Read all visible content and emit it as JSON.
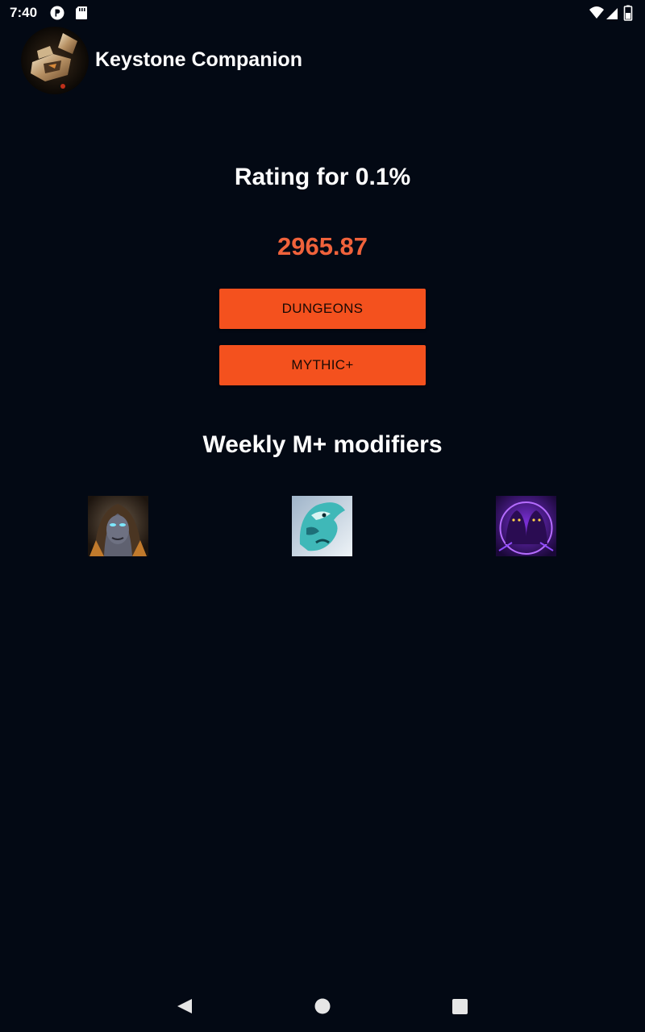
{
  "status_bar": {
    "time": "7:40",
    "left_icons": [
      "notification-p-icon",
      "sd-card-icon"
    ],
    "right_icons": [
      "wifi-icon",
      "cell-signal-icon",
      "battery-icon"
    ]
  },
  "app_bar": {
    "title": "Keystone Companion",
    "logo_icon": "keystone-logo-icon"
  },
  "rating": {
    "heading": "Rating for 0.1%",
    "value": "2965.87",
    "value_color": "#f0623b"
  },
  "buttons": {
    "dungeons_label": "DUNGEONS",
    "mythic_label": "MYTHIC+",
    "color": "#f4511e"
  },
  "modifiers": {
    "heading": "Weekly M+ modifiers",
    "affixes": [
      {
        "icon": "hooded-figure-affix-icon"
      },
      {
        "icon": "spectral-creature-affix-icon"
      },
      {
        "icon": "purple-cultists-affix-icon"
      }
    ]
  },
  "nav_bar": {
    "icons": [
      "back-icon",
      "home-icon",
      "recents-icon"
    ]
  },
  "colors": {
    "background": "#030914",
    "text": "#ffffff"
  }
}
